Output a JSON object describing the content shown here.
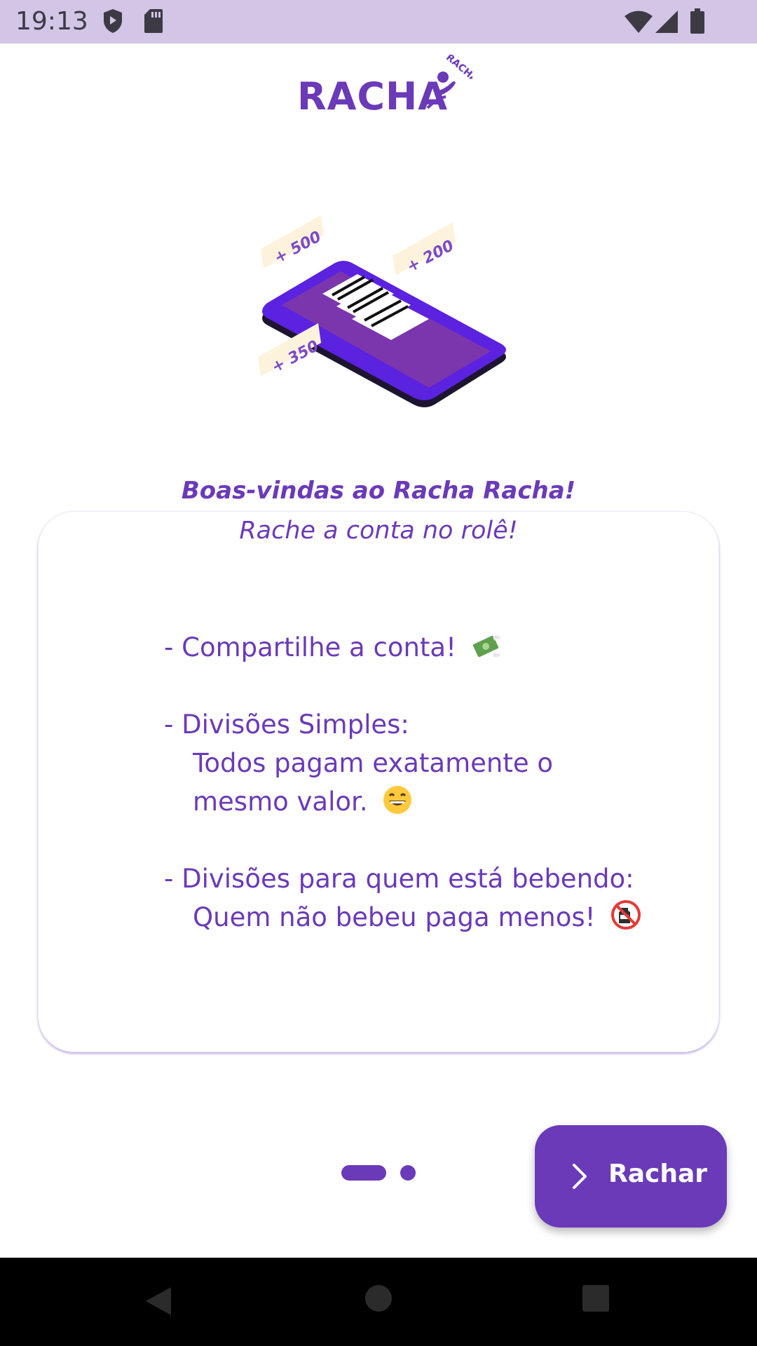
{
  "status_bar": {
    "time": "19:13",
    "left_icons": [
      "shield-icon",
      "sd-card-icon"
    ],
    "right_icons": [
      "wifi-icon",
      "signal-icon",
      "battery-icon"
    ]
  },
  "logo": {
    "word": "RACHA",
    "badge_text": "RACHA"
  },
  "illustration": {
    "tags": [
      "+ 500",
      "+ 200",
      "+ 350"
    ]
  },
  "welcome": {
    "title": "Boas-vindas ao Racha Racha!",
    "subtitle": "Rache a conta no rolê!"
  },
  "features": [
    {
      "heading": "- Compartilhe a conta!",
      "emoji": "money-with-wings-icon"
    },
    {
      "heading": "- Divisões Simples:",
      "line1": "Todos pagam exatamente o",
      "line2": "mesmo valor.",
      "emoji": "grinning-face-icon"
    },
    {
      "heading": "- Divisões para quem está bebendo:",
      "line1": "Quem não bebeu paga menos!",
      "emoji": "no-drinking-icon"
    }
  ],
  "pager": {
    "pages": 2,
    "current": 1
  },
  "fab": {
    "label": "Rachar",
    "icon": "chevron-right-icon"
  },
  "nav_bar": {
    "buttons": [
      "back-icon",
      "home-icon",
      "recents-icon"
    ]
  },
  "colors": {
    "accent": "#6a3ab9",
    "status_bar": "#d2c5e6",
    "tag_bg": "#fdf3dc"
  }
}
